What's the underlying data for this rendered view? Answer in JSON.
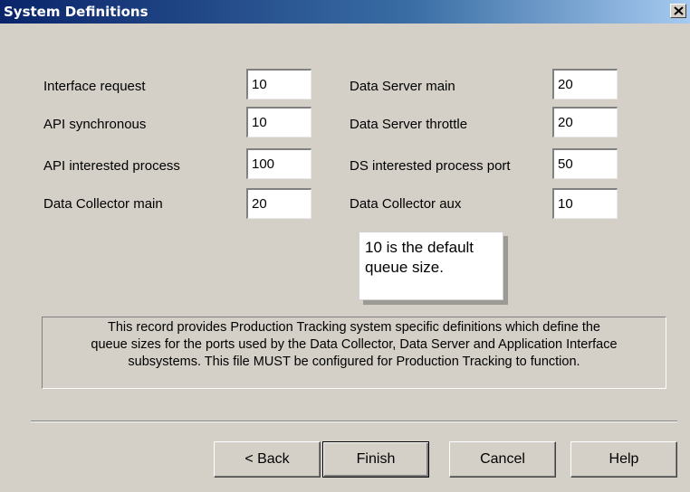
{
  "window": {
    "title": "System Definitions"
  },
  "fields": {
    "left": [
      {
        "label": "Interface request",
        "value": "10"
      },
      {
        "label": "API synchronous",
        "value": "10"
      },
      {
        "label": "API interested process",
        "value": "100"
      },
      {
        "label": "Data Collector main",
        "value": "20"
      }
    ],
    "right": [
      {
        "label": "Data Server main",
        "value": "20"
      },
      {
        "label": "Data Server throttle",
        "value": "20"
      },
      {
        "label": "DS interested process port",
        "value": "50"
      },
      {
        "label": "Data Collector aux",
        "value": "10"
      }
    ]
  },
  "tooltip": {
    "line1": "10 is the default",
    "line2": "queue size."
  },
  "description": {
    "line1": "This record provides Production Tracking system specific definitions which define the",
    "line2": "queue sizes for the ports used by the Data Collector, Data Server and Application Interface",
    "line3": "subsystems. This file MUST be configured for Production Tracking to function."
  },
  "buttons": {
    "back": "< Back",
    "finish": "Finish",
    "cancel": "Cancel",
    "help": "Help"
  },
  "icons": {
    "close": "close-icon"
  }
}
